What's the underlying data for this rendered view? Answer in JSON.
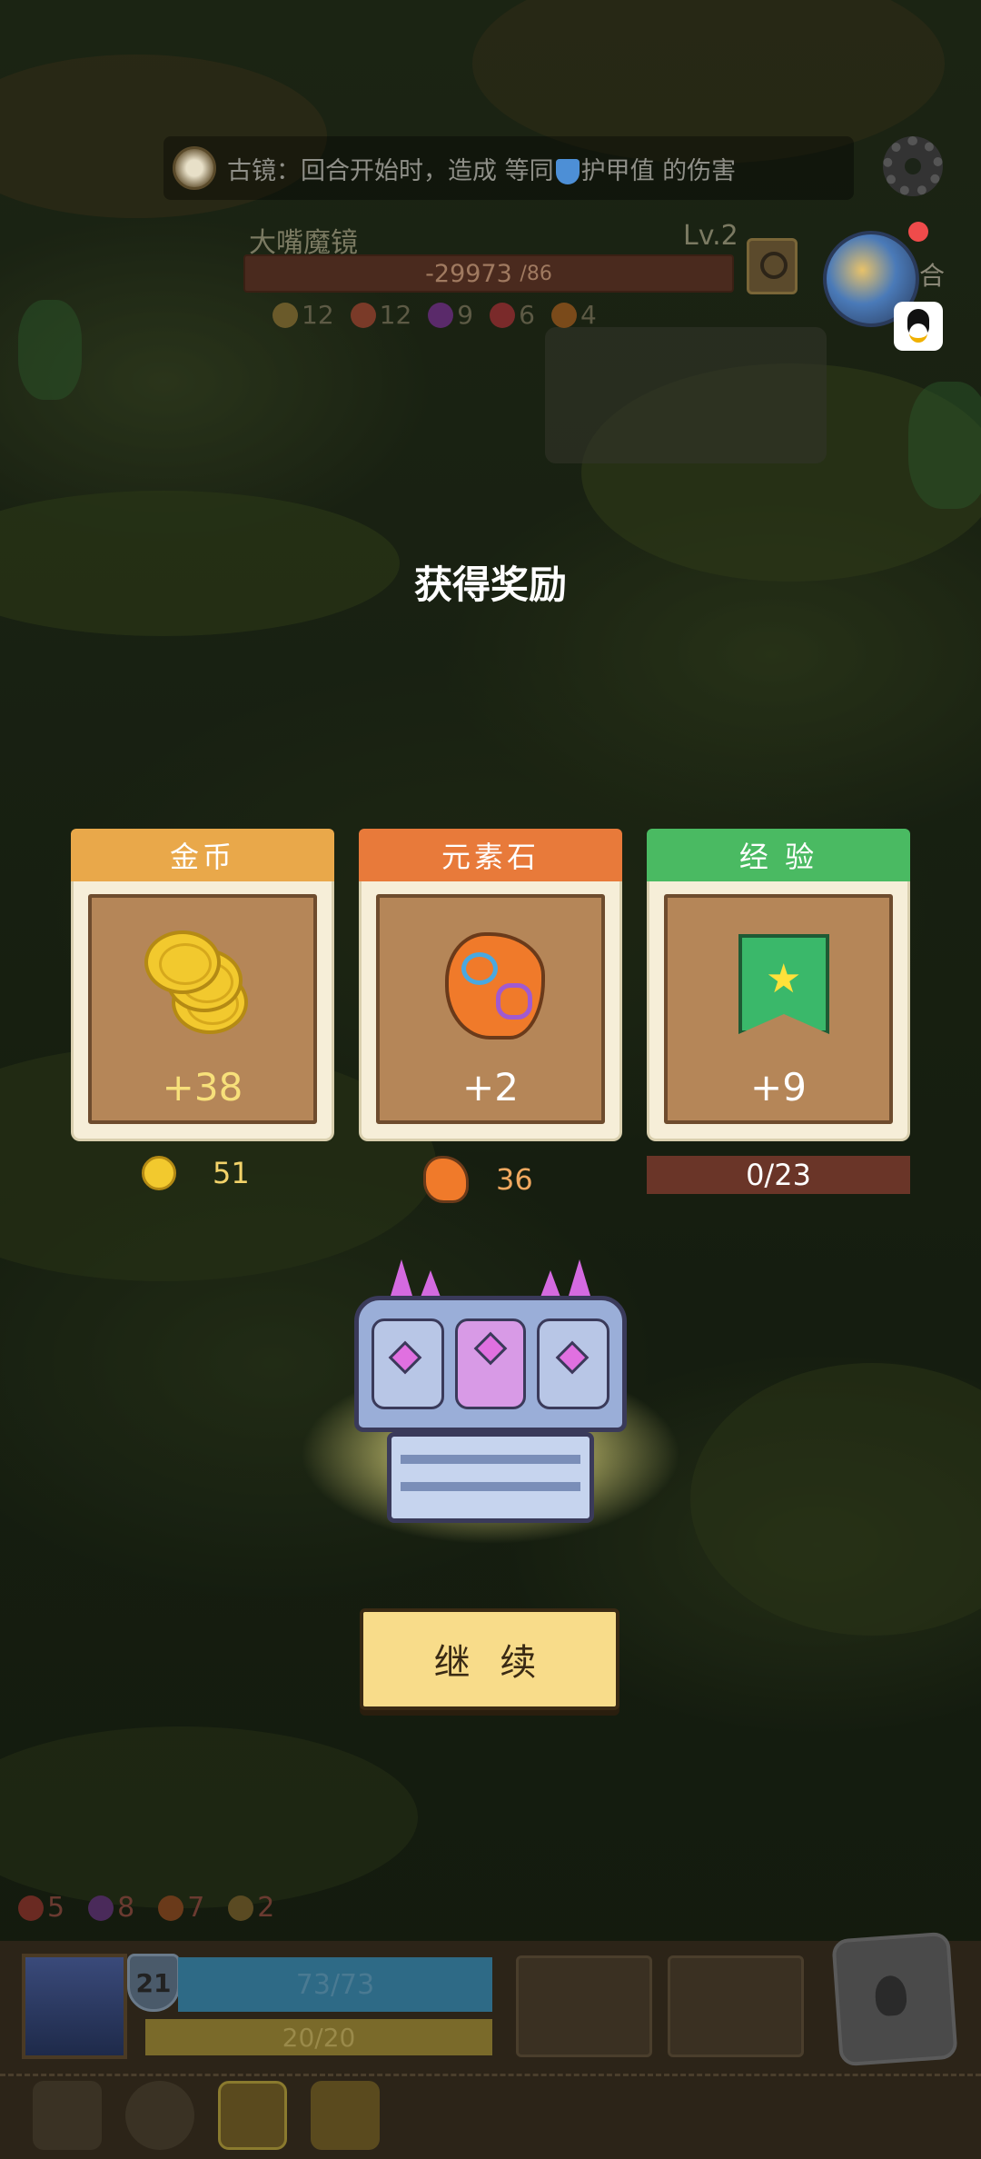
{
  "hint": {
    "prefix": "古镜：",
    "text_before": "回合开始时，造成 等同",
    "text_after": "护甲值 的伤害"
  },
  "enemy": {
    "name": "大嘴魔镜",
    "level": "Lv.2",
    "hp_current": "-29973",
    "hp_max": "/86",
    "elements": [
      {
        "icon": "leaf-icon",
        "count": "12",
        "color": "#6a5a2a"
      },
      {
        "icon": "flame-icon",
        "count": "12",
        "color": "#7a3a28"
      },
      {
        "icon": "spark-icon",
        "count": "9",
        "color": "#5a2a6a"
      },
      {
        "icon": "blood-icon",
        "count": "6",
        "color": "#7a2a2a"
      },
      {
        "icon": "fire-icon",
        "count": "4",
        "color": "#7a4a1a"
      }
    ]
  },
  "side": {
    "label": "合"
  },
  "reward": {
    "title": "获得奖励",
    "cards": [
      {
        "header": "金币",
        "value": "+38",
        "header_color": "#e9a84a",
        "value_color": "#f7e07a"
      },
      {
        "header": "元素石",
        "value": "+2",
        "header_color": "#e87a3a",
        "value_color": "#ffffff"
      },
      {
        "header": "经 验",
        "value": "+9",
        "header_color": "#4aba62",
        "value_color": "#ffffff"
      }
    ],
    "gold_total": "51",
    "stone_total": "36",
    "xp_progress": "0/23",
    "xp_fill": 0
  },
  "continue_label": "继 续",
  "player": {
    "elements": [
      {
        "icon": "blood-icon",
        "count": "5"
      },
      {
        "icon": "spark-icon",
        "count": "8"
      },
      {
        "icon": "fire-icon",
        "count": "7"
      },
      {
        "icon": "leaf-icon",
        "count": "2"
      }
    ],
    "level": "21",
    "hp": "73/73",
    "mp": "20/20"
  },
  "colors": {
    "title": "#ffffff",
    "gold_text": "#f3d36a",
    "stone_text": "#f0a860",
    "continue_bg": "#f8dc8a",
    "xp_bar": "#6a3528"
  }
}
